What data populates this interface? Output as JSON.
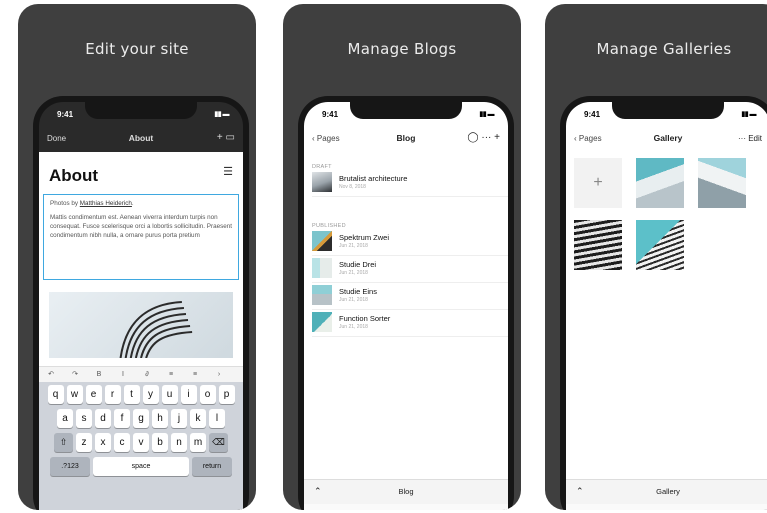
{
  "cards": [
    {
      "title": "Edit your site",
      "status_time": "9:41",
      "nav": {
        "left": "Done",
        "center": "About",
        "right": "+ ▭"
      },
      "page_title": "About",
      "text_line1_prefix": "Photos by ",
      "text_line1_link": "Matthias Heiderich",
      "text_line1_suffix": ".",
      "text_body": "Mattis condimentum est. Aenean viverra interdum turpis non consequat. Fusce scelerisque orci a lobortis sollicitudin. Praesent condimentum nibh nulla, a ornare purus porta pretium",
      "toolbar": [
        "↶",
        "↷",
        "B",
        "I",
        "∂",
        "≡",
        "≡",
        "›"
      ],
      "keyboard": {
        "row1": [
          "q",
          "w",
          "e",
          "r",
          "t",
          "y",
          "u",
          "i",
          "o",
          "p"
        ],
        "row2": [
          "a",
          "s",
          "d",
          "f",
          "g",
          "h",
          "j",
          "k",
          "l"
        ],
        "row3": [
          "z",
          "x",
          "c",
          "v",
          "b",
          "n",
          "m"
        ],
        "key_123": ".?123",
        "key_space": "space",
        "key_return": "return"
      }
    },
    {
      "title": "Manage Blogs",
      "status_time": "9:41",
      "nav": {
        "left": "‹ Pages",
        "center": "Blog",
        "right": "◯ ··· +"
      },
      "draft_label": "DRAFT",
      "drafts": [
        {
          "title": "Brutalist architecture",
          "date": "Nov 8, 2018"
        }
      ],
      "published_label": "PUBLISHED",
      "published": [
        {
          "title": "Spektrum Zwei",
          "date": "Jun 21, 2018"
        },
        {
          "title": "Studie Drei",
          "date": "Jun 21, 2018"
        },
        {
          "title": "Studie Eins",
          "date": "Jun 21, 2018"
        },
        {
          "title": "Function Sorter",
          "date": "Jun 21, 2018"
        }
      ],
      "bottom_label": "Blog"
    },
    {
      "title": "Manage Galleries",
      "status_time": "9:41",
      "nav": {
        "left": "‹ Pages",
        "center": "Gallery",
        "right": "···  Edit"
      },
      "add_glyph": "+",
      "bottom_label": "Gallery"
    }
  ],
  "colors": {
    "card_bg": "#3f3f3f",
    "selection": "#3fa8e0",
    "teal": "#5fb9c4"
  }
}
